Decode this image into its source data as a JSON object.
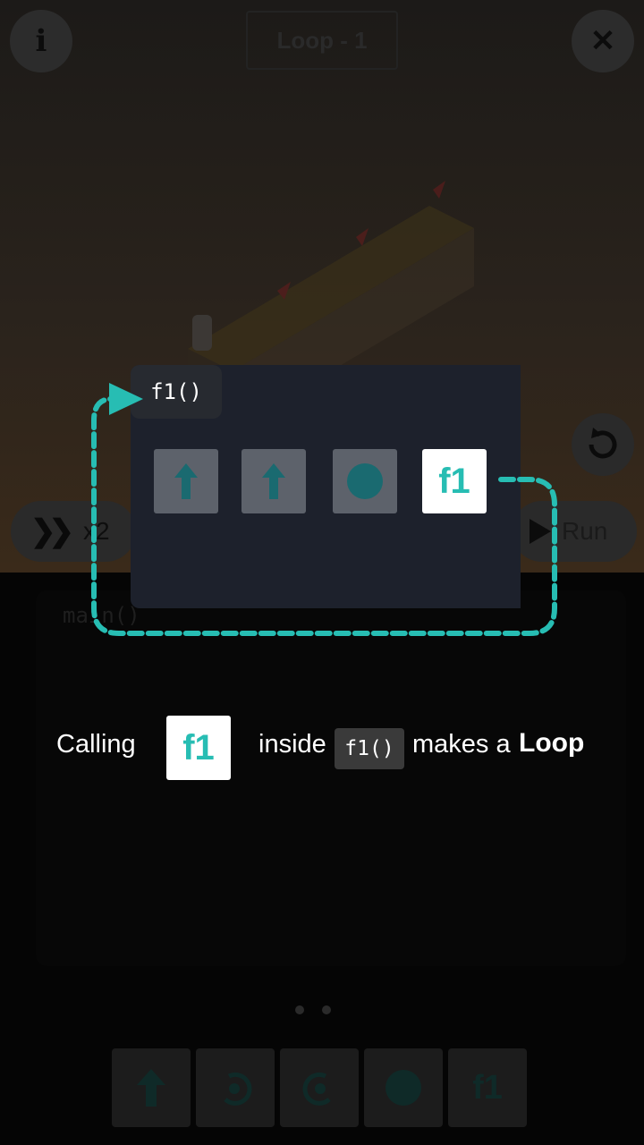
{
  "header": {
    "title": "Loop - 1",
    "info_icon": "i",
    "close_icon": "✕"
  },
  "controls": {
    "speed_label": "x2",
    "run_label": "Run"
  },
  "editor": {
    "main_label": "main()"
  },
  "tutorial": {
    "function_tab": "f1()",
    "blocks": [
      "forward-arrow",
      "forward-arrow",
      "light-circle",
      "f1"
    ],
    "f1_block_label": "f1",
    "caption_calling": "Calling",
    "caption_f1": "f1",
    "caption_inside": "inside",
    "caption_code": "f1()",
    "caption_makes": "makes a",
    "caption_loop": "Loop",
    "accent_color": "#27bdb3"
  },
  "palette": {
    "items": [
      "forward-arrow-icon",
      "turn-left-icon",
      "turn-right-icon",
      "light-icon",
      "f1"
    ],
    "f1_label": "f1"
  },
  "pagination": {
    "pages": 2,
    "current": 1
  }
}
